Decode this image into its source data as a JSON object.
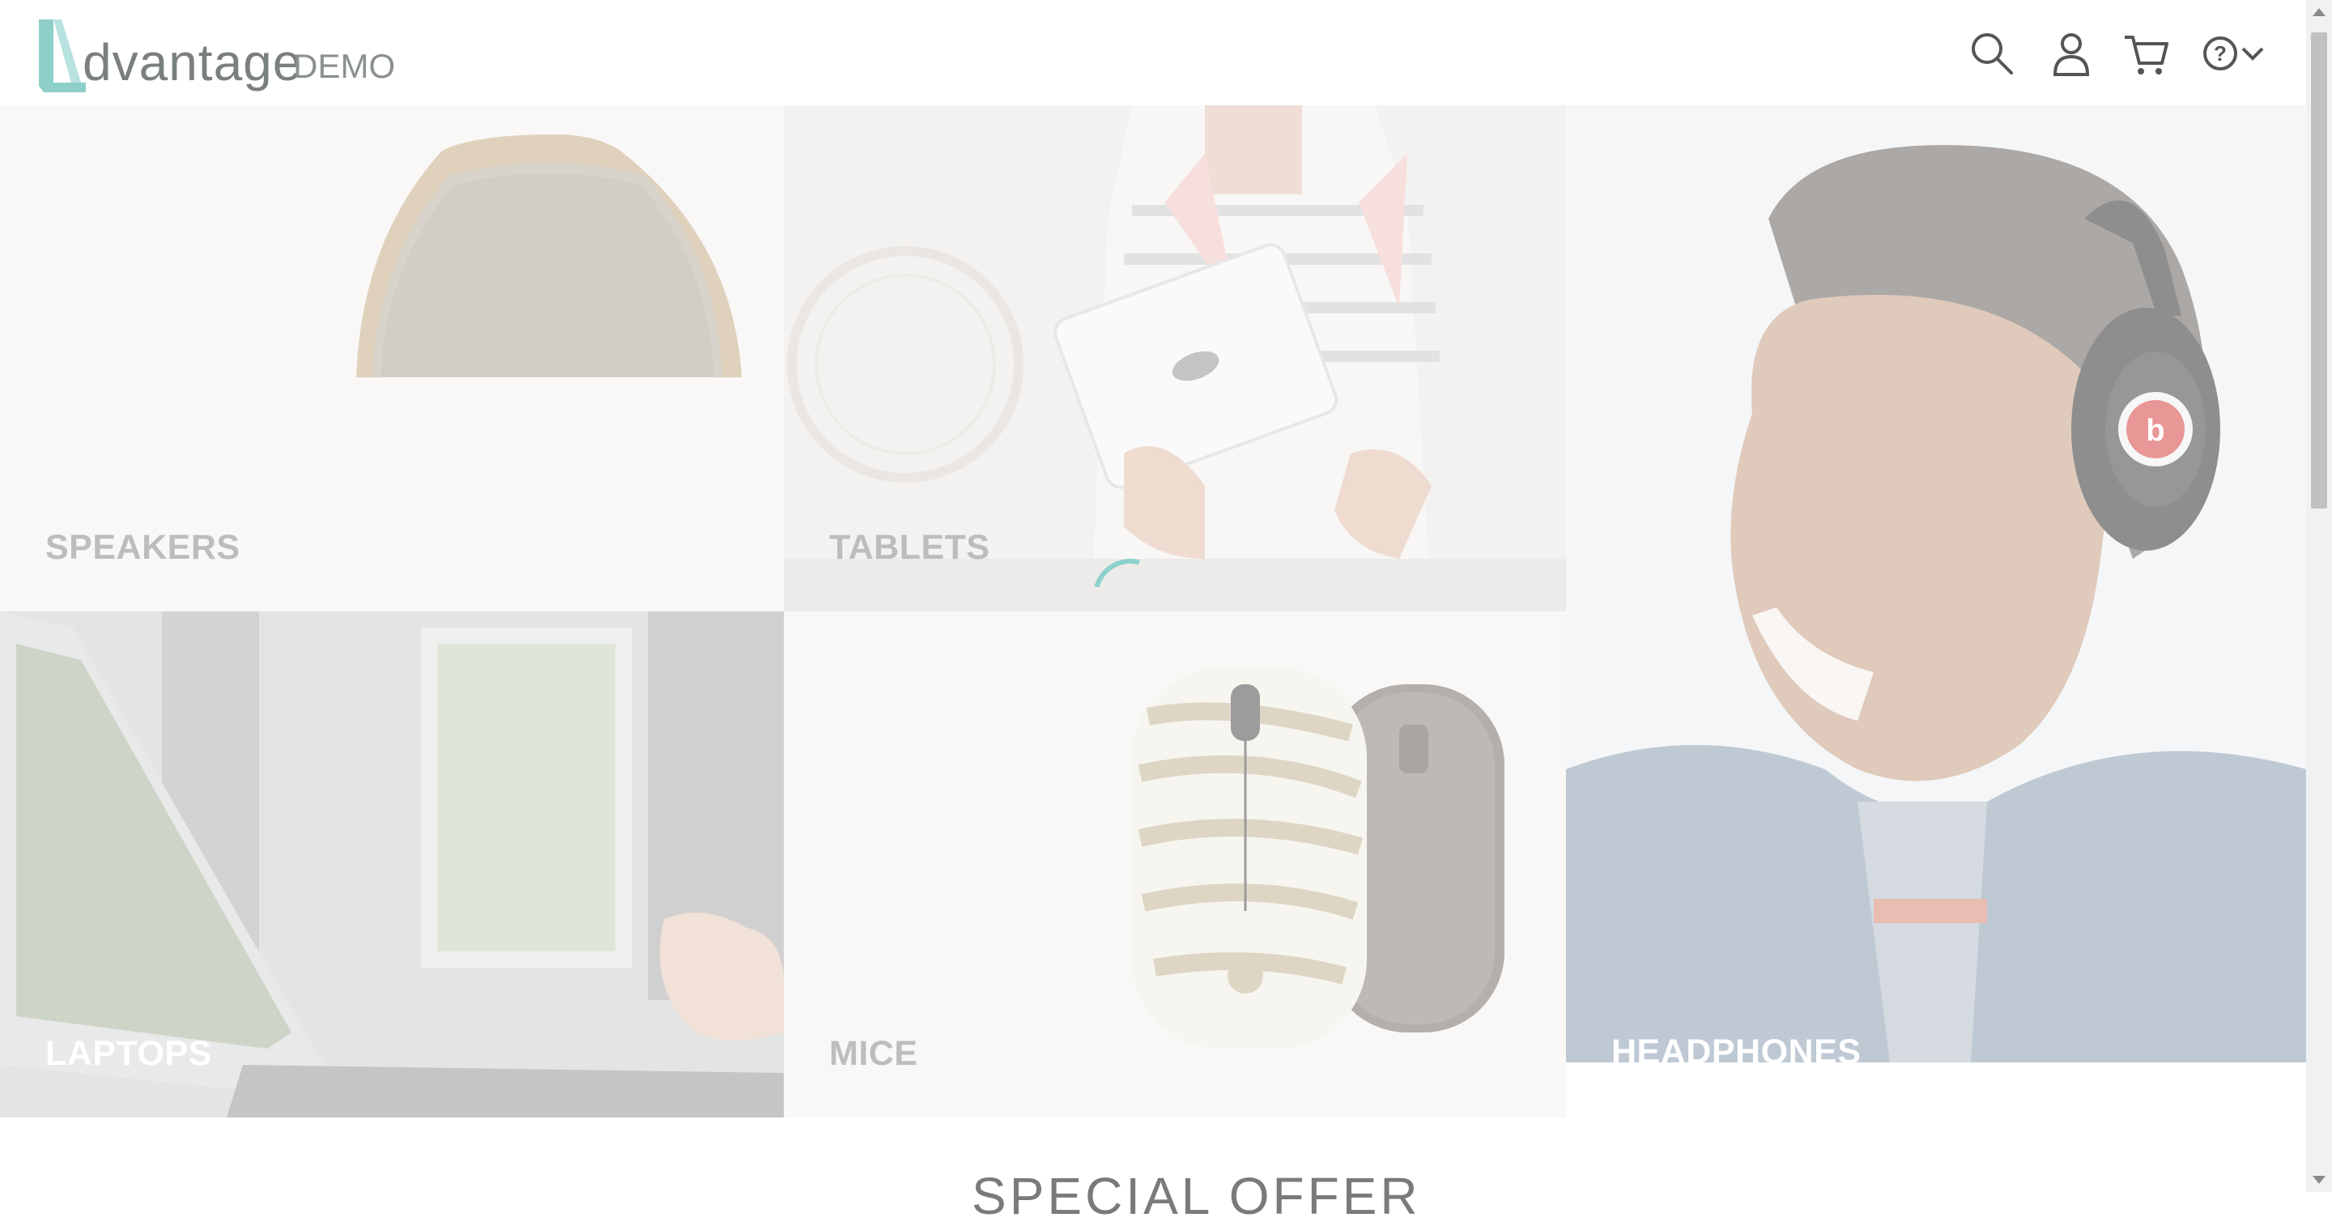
{
  "header": {
    "logo_text": "dvantage",
    "logo_suffix": "DEMO",
    "icons": [
      "search-icon",
      "user-icon",
      "cart-icon",
      "help-icon",
      "chevron-down-icon"
    ]
  },
  "categories": {
    "speakers": "SPEAKERS",
    "tablets": "TABLETS",
    "headphones": "HEADPHONES",
    "laptops": "LAPTOPS",
    "mice": "MICE"
  },
  "offer": {
    "title": "SPECIAL OFFER"
  },
  "colors": {
    "brand_teal": "#3bb0a8",
    "logo_gray": "#7a7f80",
    "tile_label_gray": "#8e8e8e"
  }
}
